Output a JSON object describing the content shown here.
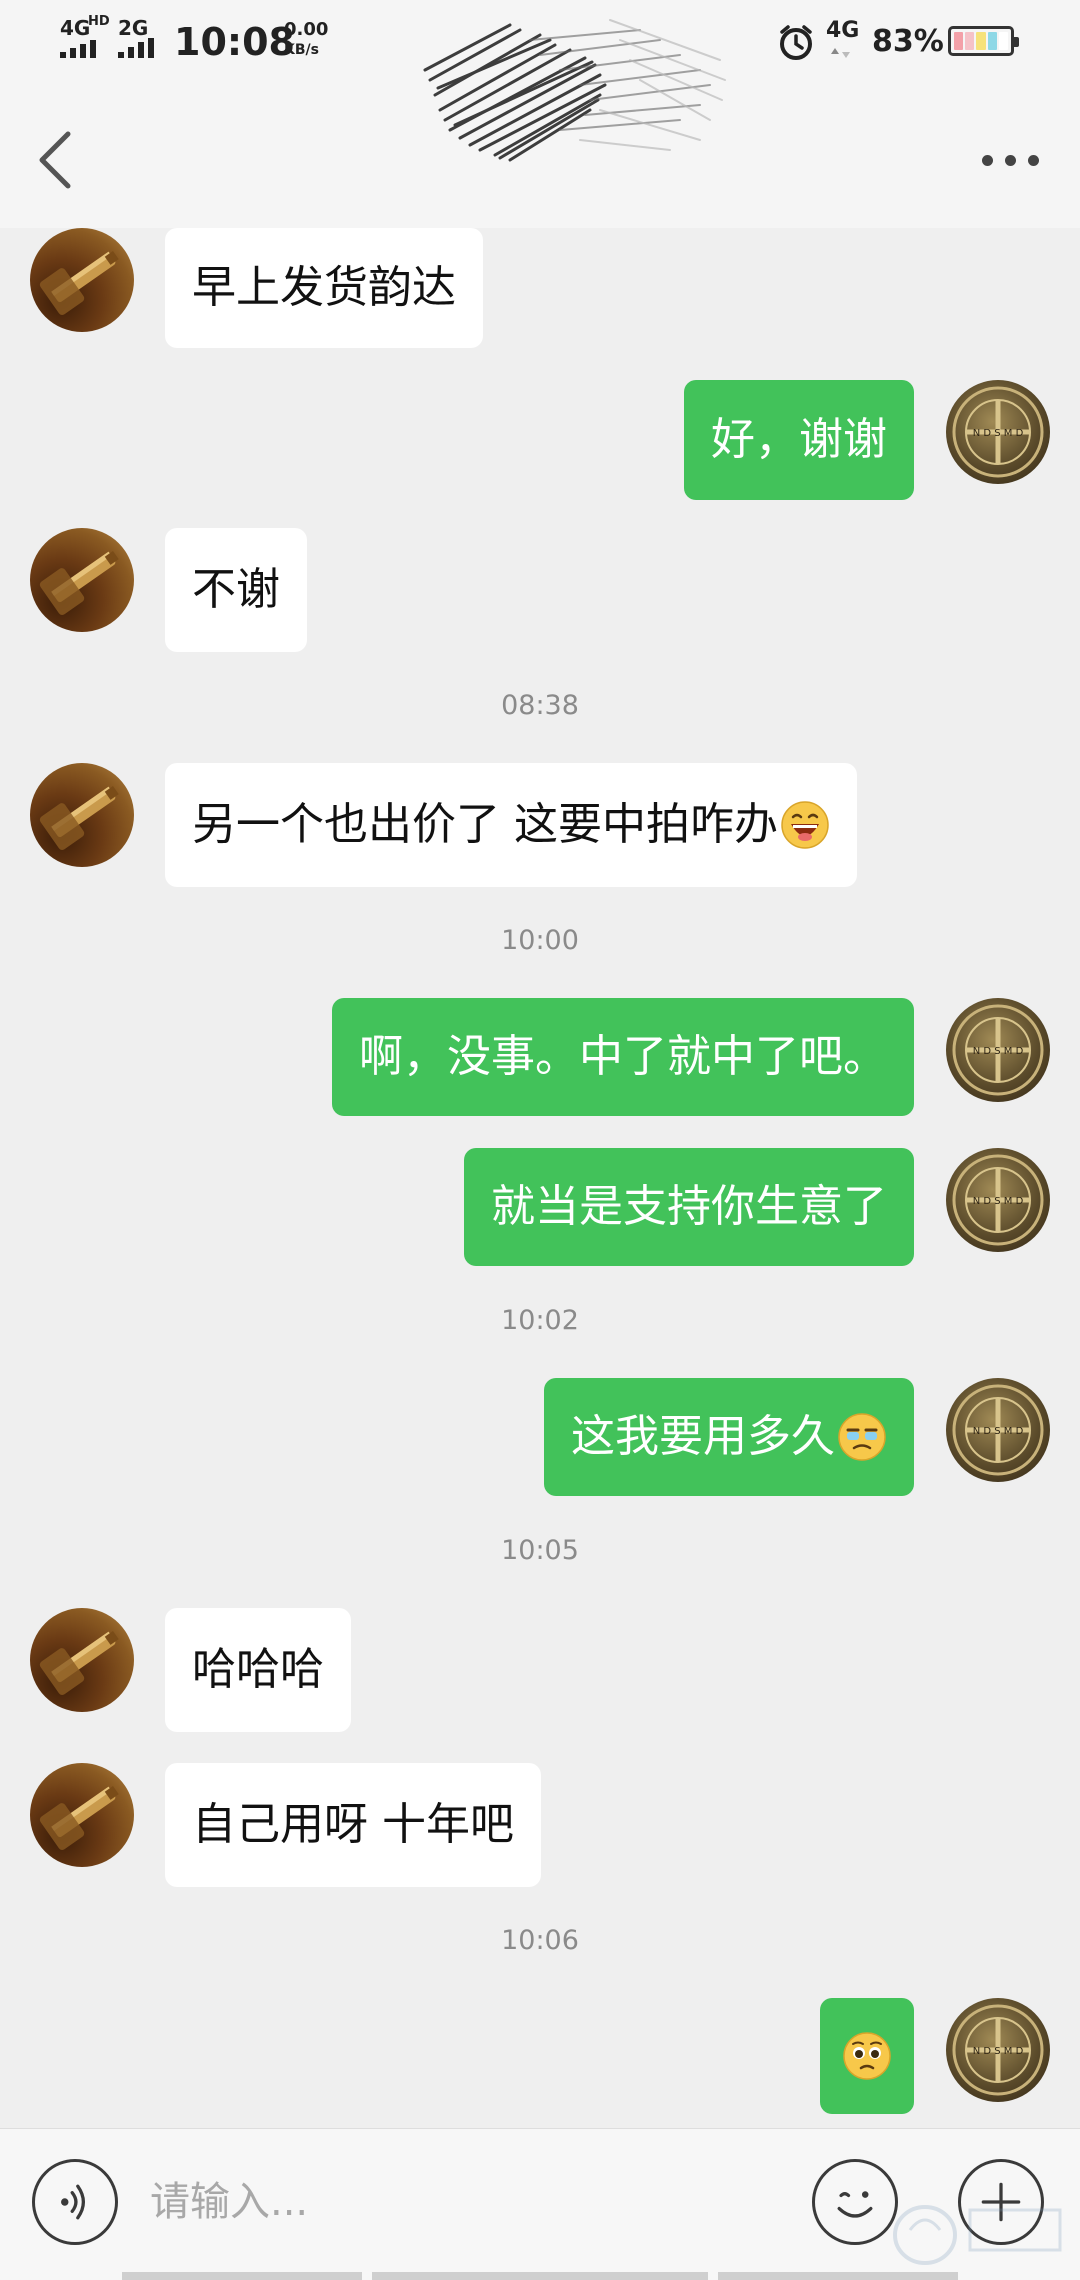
{
  "status_bar": {
    "network_1": "4G",
    "network_1_sup": "HD",
    "network_2": "2G",
    "time": "10:08",
    "speed_value": "0.00",
    "speed_unit": "KB/s",
    "network_3": "4G",
    "battery_percent": "83%",
    "battery_level": 0.83,
    "battery_segment_colors": [
      "#f3a0a8",
      "#f5c2c8",
      "#f6e27a",
      "#8ed8e6"
    ]
  },
  "header": {
    "back_icon": "chevron-left-icon",
    "more_icon": "more-dots-icon",
    "title_obscured": true
  },
  "messages": [
    {
      "side": "in",
      "text": "早上发货韵达",
      "emoji": null
    },
    {
      "side": "out",
      "text": "好，谢谢",
      "emoji": null
    },
    {
      "side": "in",
      "text": "不谢",
      "emoji": null
    },
    {
      "side": "in",
      "text": "另一个也出价了 这要中拍咋办",
      "emoji": "laughing-emoji"
    },
    {
      "side": "out",
      "text": "啊，没事。中了就中了吧。",
      "emoji": null
    },
    {
      "side": "out",
      "text": "就当是支持你生意了",
      "emoji": null
    },
    {
      "side": "out",
      "text": "这我要用多久",
      "emoji": "crying-emoji"
    },
    {
      "side": "in",
      "text": "哈哈哈",
      "emoji": null
    },
    {
      "side": "in",
      "text": "自己用呀 十年吧",
      "emoji": null
    },
    {
      "side": "out",
      "text": "",
      "emoji": "pleading-emoji"
    }
  ],
  "timestamps": [
    "08:38",
    "10:00",
    "10:02",
    "10:05",
    "10:06"
  ],
  "input_bar": {
    "voice_icon": "voice-icon",
    "placeholder": "请输入...",
    "emoji_icon": "emoji-face-icon",
    "plus_icon": "plus-icon"
  },
  "colors": {
    "outgoing_bubble": "#42c25a",
    "incoming_bubble": "#ffffff",
    "background": "#efefef"
  }
}
